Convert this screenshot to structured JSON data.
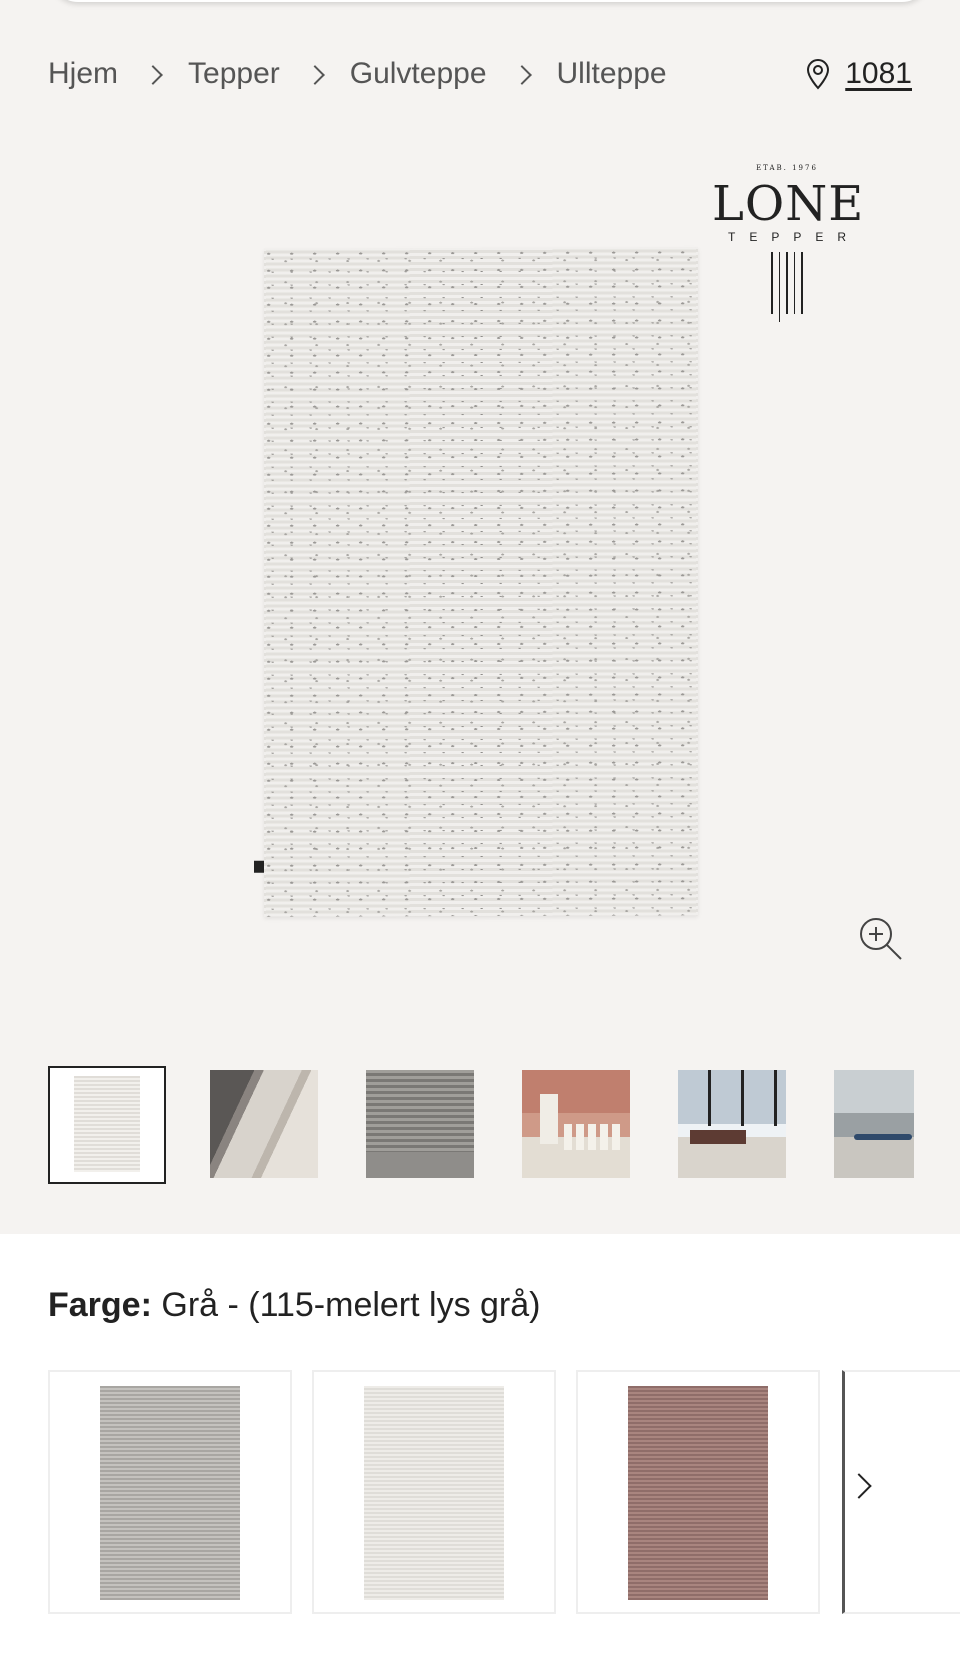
{
  "breadcrumb": {
    "items": [
      "Hjem",
      "Tepper",
      "Gulvteppe",
      "Ullteppe"
    ]
  },
  "store": {
    "icon": "location-pin-icon",
    "label": "1081"
  },
  "brand": {
    "established": "ETAB. 1976",
    "name": "LONE",
    "sub": "TEPPER"
  },
  "gallery": {
    "zoom_icon": "zoom-in-icon",
    "thumbnails": [
      "rug-front",
      "rug-rolls",
      "rug-closeup",
      "dining-room",
      "living-room",
      "room-with-sofa"
    ],
    "active_index": 0
  },
  "color_option": {
    "label": "Farge:",
    "value": "Grå - (115-melert lys grå)",
    "swatches": [
      "grey",
      "light-grey",
      "rose"
    ],
    "next_icon": "chevron-right-icon"
  },
  "colors": {
    "background": "#f5f3f1",
    "text": "#222222",
    "muted": "#555555"
  }
}
